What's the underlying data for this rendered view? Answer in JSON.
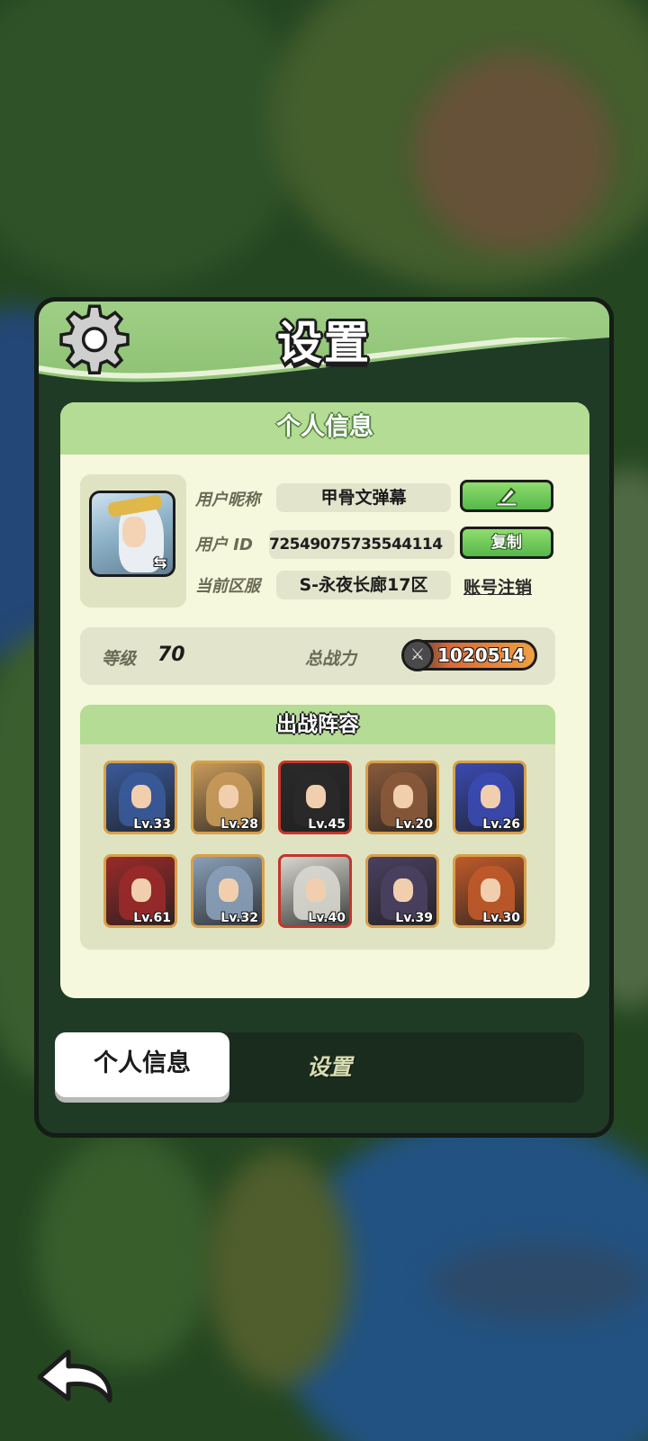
{
  "panel": {
    "title": "设置",
    "section_title": "个人信息",
    "profile": {
      "nickname_label": "用户昵称",
      "nickname": "甲骨文弹幕",
      "id_label": "用户 ID",
      "user_id": "72549075735544114",
      "server_label": "当前区服",
      "server": "S-永夜长廊17区",
      "copy_label": "复制",
      "logout_label": "账号注销",
      "edit_icon": "pen-icon",
      "swap_icon": "swap-icon"
    },
    "stats": {
      "level_label": "等级",
      "level": "70",
      "power_label": "总战力",
      "power": "1020514"
    },
    "lineup": {
      "title": "出战阵容",
      "heroes": [
        {
          "level": "Lv.33",
          "frame": "gold",
          "color": "#3a5a9a"
        },
        {
          "level": "Lv.28",
          "frame": "gold",
          "color": "#c89a5a"
        },
        {
          "level": "Lv.45",
          "frame": "red",
          "color": "#2a2a2a"
        },
        {
          "level": "Lv.20",
          "frame": "gold",
          "color": "#8a5a3a"
        },
        {
          "level": "Lv.26",
          "frame": "gold",
          "color": "#3a4ab0"
        },
        {
          "level": "Lv.61",
          "frame": "gold",
          "color": "#9a2a2a"
        },
        {
          "level": "Lv.32",
          "frame": "gold",
          "color": "#8aa0b8"
        },
        {
          "level": "Lv.40",
          "frame": "red",
          "color": "#d8d8d0"
        },
        {
          "level": "Lv.39",
          "frame": "gold",
          "color": "#4a4060"
        },
        {
          "level": "Lv.30",
          "frame": "gold",
          "color": "#c05a2a"
        }
      ]
    },
    "tabs": {
      "active": "个人信息",
      "inactive": "设置"
    }
  },
  "colors": {
    "panel_green": "#9fcf86",
    "card_bg": "#f5f8dc",
    "button_green": "#56b84a",
    "panel_dark": "#1f3a25"
  }
}
